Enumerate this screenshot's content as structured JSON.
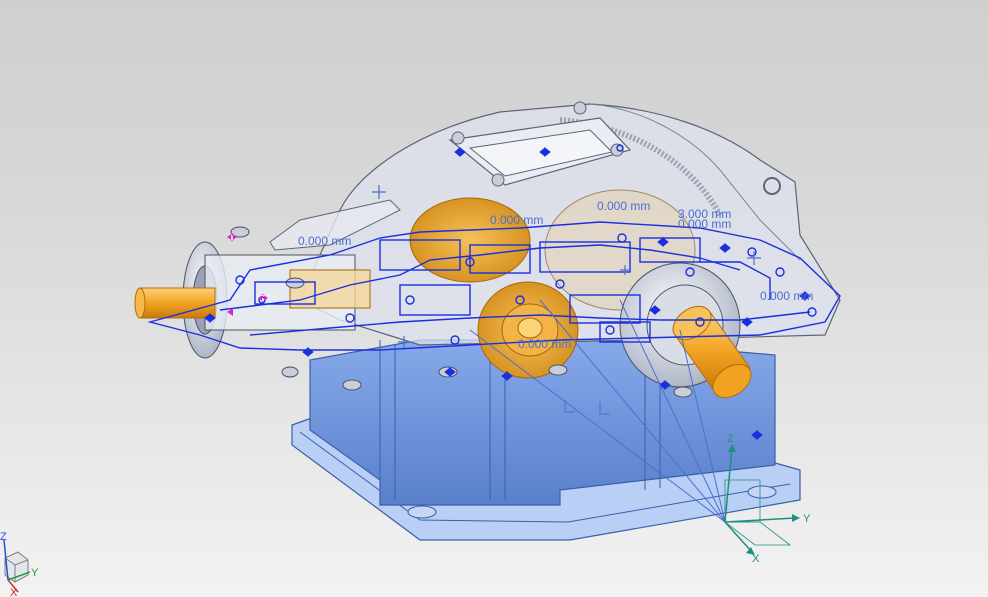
{
  "viewport": {
    "background_top": "#cfcfcf",
    "background_bottom": "#f2f2f2"
  },
  "model": {
    "housing_color": "#6f95dc",
    "housing_edge_color": "#3b5ea8",
    "cover_color": "#d7dbe3",
    "shaft_color": "#f2a221",
    "gear_color": "#e6b04a",
    "sketch_color": "#1a2fe0",
    "constraint_color": "#1a2fe0"
  },
  "dimensions": {
    "dim1": "0.000 mm",
    "dim2": "0.000 mm",
    "dim3": "3.000 mm",
    "dim4": "0.000 mm",
    "dim5": "0.000 mm",
    "dim6": "0.000 mm"
  },
  "datum_csys": {
    "x": "X",
    "y": "Y",
    "z": "Z"
  },
  "view_triad": {
    "x": "X",
    "y": "Y",
    "z": "Z"
  }
}
